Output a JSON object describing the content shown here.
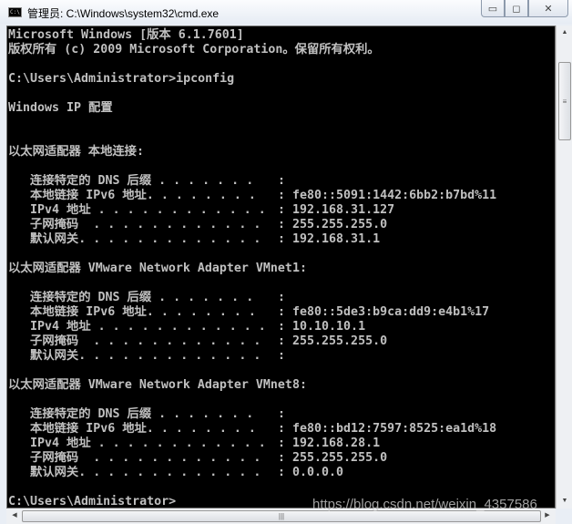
{
  "window": {
    "title": "管理员: C:\\Windows\\system32\\cmd.exe",
    "icon": "cmd-icon",
    "buttons": [
      "minimize",
      "maximize",
      "close"
    ]
  },
  "terminal": {
    "header": [
      "Microsoft Windows [版本 6.1.7601]",
      "版权所有 (c) 2009 Microsoft Corporation。保留所有权利。",
      "",
      "C:\\Users\\Administrator>ipconfig",
      "",
      "Windows IP 配置",
      "",
      ""
    ],
    "adapters": [
      {
        "title": "以太网适配器 本地连接:",
        "rows": [
          {
            "label": "   连接特定的 DNS 后缀 . . . . . . . ",
            "value": ""
          },
          {
            "label": "   本地链接 IPv6 地址. . . . . . . . ",
            "value": "fe80::5091:1442:6bb2:b7bd%11"
          },
          {
            "label": "   IPv4 地址 . . . . . . . . . . . . ",
            "value": "192.168.31.127"
          },
          {
            "label": "   子网掩码  . . . . . . . . . . . . ",
            "value": "255.255.255.0"
          },
          {
            "label": "   默认网关. . . . . . . . . . . . . ",
            "value": "192.168.31.1"
          }
        ]
      },
      {
        "title": "以太网适配器 VMware Network Adapter VMnet1:",
        "rows": [
          {
            "label": "   连接特定的 DNS 后缀 . . . . . . . ",
            "value": ""
          },
          {
            "label": "   本地链接 IPv6 地址. . . . . . . . ",
            "value": "fe80::5de3:b9ca:dd9:e4b1%17"
          },
          {
            "label": "   IPv4 地址 . . . . . . . . . . . . ",
            "value": "10.10.10.1"
          },
          {
            "label": "   子网掩码  . . . . . . . . . . . . ",
            "value": "255.255.255.0"
          },
          {
            "label": "   默认网关. . . . . . . . . . . . . ",
            "value": ""
          }
        ]
      },
      {
        "title": "以太网适配器 VMware Network Adapter VMnet8:",
        "rows": [
          {
            "label": "   连接特定的 DNS 后缀 . . . . . . . ",
            "value": ""
          },
          {
            "label": "   本地链接 IPv6 地址. . . . . . . . ",
            "value": "fe80::bd12:7597:8525:ea1d%18"
          },
          {
            "label": "   IPv4 地址 . . . . . . . . . . . . ",
            "value": "192.168.28.1"
          },
          {
            "label": "   子网掩码  . . . . . . . . . . . . ",
            "value": "255.255.255.0"
          },
          {
            "label": "   默认网关. . . . . . . . . . . . . ",
            "value": "0.0.0.0"
          }
        ]
      }
    ],
    "prompt": "C:\\Users\\Administrator>"
  },
  "watermark": "https://blog.csdn.net/weixin_4357586"
}
